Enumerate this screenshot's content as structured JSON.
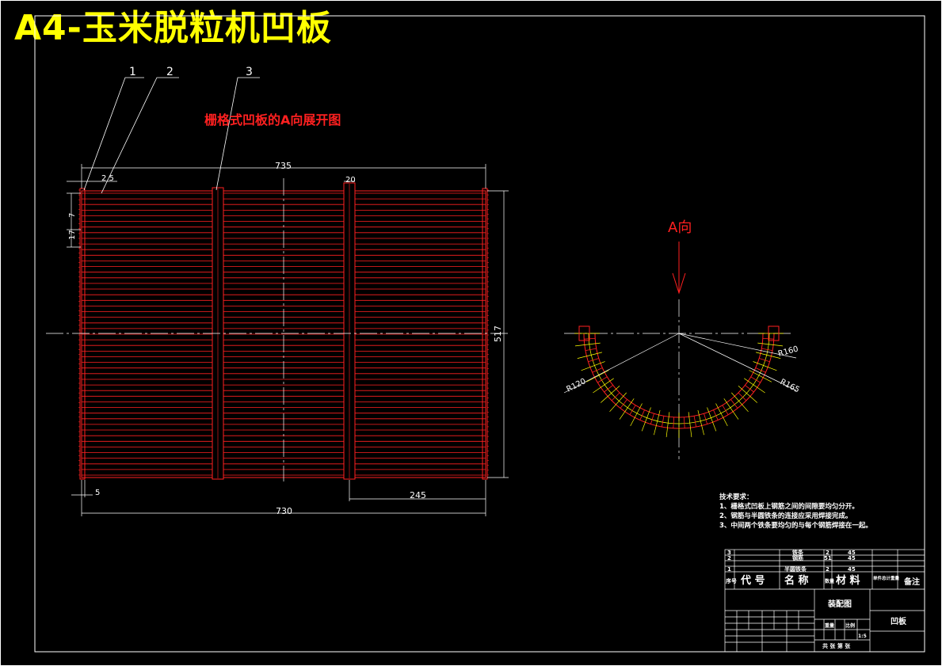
{
  "title": "A4-玉米脱粒机凹板",
  "view_title": "栅格式凹板的A向展开图",
  "direction_label": "A向",
  "leaders": [
    "1",
    "2",
    "3"
  ],
  "dimensions": {
    "top_length": "735",
    "bar_width": "20",
    "gap": "2.5",
    "pitch_small": "7",
    "pitch_large": "17",
    "height": "517",
    "edge": "5",
    "right_offset": "245",
    "bottom_length": "730",
    "r_inner": "R160",
    "r_outer": "R165",
    "r_small": "R120"
  },
  "tech_requirements": {
    "heading": "技术要求：",
    "items": [
      "1、栅格式凹板上钢筋之间的间隙要均匀分开。",
      "2、钢筋与半圆铁条的连接应采用焊接完成。",
      "3、中间两个铁条要均匀的与每个钢筋焊接在一起。"
    ]
  },
  "title_block": {
    "parts": [
      {
        "no": "3",
        "name": "铁条",
        "qty": "2",
        "material": "45"
      },
      {
        "no": "2",
        "name": "钢筋",
        "qty": "51",
        "material": "45"
      },
      {
        "no": "1",
        "name": "半圆铁条",
        "qty": "2",
        "material": "45"
      }
    ],
    "header": {
      "no": "序号",
      "code": "代 号",
      "name": "名 称",
      "qty": "数量",
      "material": "材 料",
      "weight": "单件总计重量",
      "remark": "备注"
    },
    "assembly_label": "装配图",
    "drawing_name": "凹板",
    "scale_label": "比例",
    "scale": "1:5",
    "weight_label": "重量",
    "sheet_text": "共 张 第 张"
  }
}
